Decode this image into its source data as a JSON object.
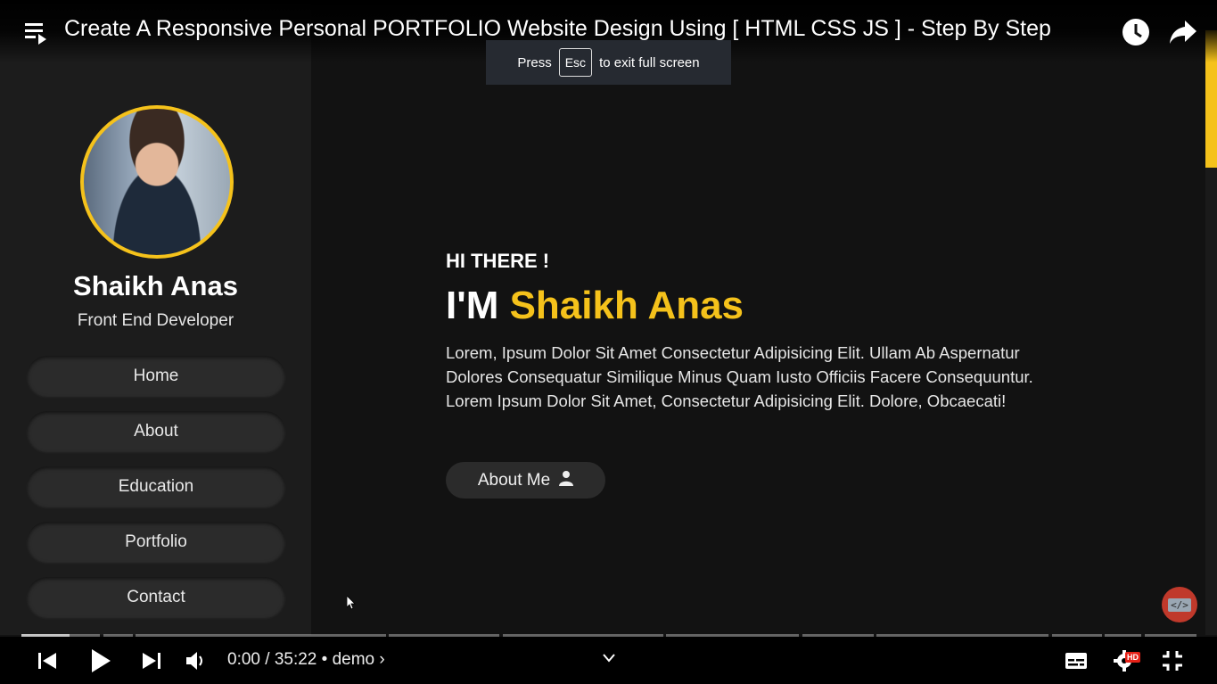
{
  "video": {
    "title": "Create A Responsive Personal PORTFOLIO Website Design Using [ HTML CSS JS ] - Step By Step",
    "fullscreen_toast": {
      "press": "Press",
      "key": "Esc",
      "suffix": "to exit full screen"
    }
  },
  "site": {
    "profile": {
      "name": "Shaikh Anas",
      "role": "Front End Developer"
    },
    "nav": [
      "Home",
      "About",
      "Education",
      "Portfolio",
      "Contact"
    ],
    "hero": {
      "greeting": "HI THERE !",
      "prefix": "I'M",
      "highlight": "Shaikh Anas",
      "description": "Lorem, Ipsum Dolor Sit Amet Consectetur Adipisicing Elit. Ullam Ab Aspernatur Dolores Consequatur Similique Minus Quam Iusto Officiis Facere Consequuntur. Lorem Ipsum Dolor Sit Amet, Consectetur Adipisicing Elit. Dolore, Obcaecati!",
      "button": "About Me"
    },
    "colors": {
      "accent": "#f5c21b",
      "sidebar": "#1c1c1c",
      "background": "#121212"
    }
  },
  "player": {
    "time": "0:00 / 35:22",
    "separator": "•",
    "chapter": "demo",
    "icons": [
      "previous-icon",
      "play-icon",
      "next-icon",
      "volume-icon",
      "chevron-down-icon",
      "subtitles-icon",
      "settings-icon",
      "exit-fullscreen-icon"
    ],
    "hd_badge": "HD"
  }
}
